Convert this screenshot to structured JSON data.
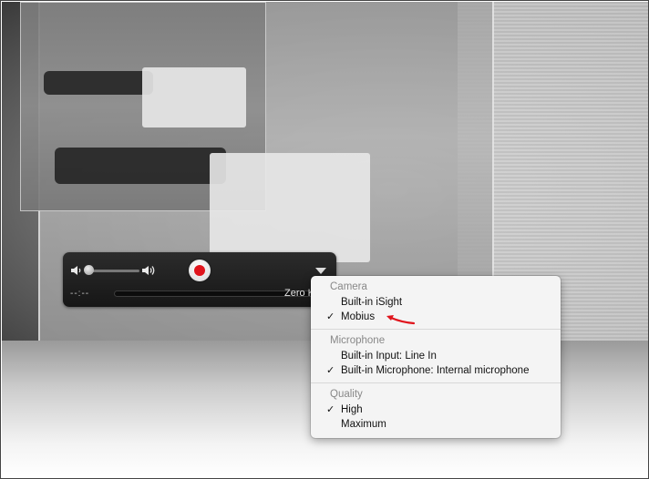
{
  "control_bar": {
    "time_display": "--:--",
    "size_display": "Zero KB",
    "record_color": "#e0141c"
  },
  "menu": {
    "sections": [
      {
        "header": "Camera",
        "items": [
          {
            "label": "Built-in iSight",
            "checked": false
          },
          {
            "label": "Mobius",
            "checked": true
          }
        ]
      },
      {
        "header": "Microphone",
        "items": [
          {
            "label": "Built-in Input: Line In",
            "checked": false
          },
          {
            "label": "Built-in Microphone: Internal microphone",
            "checked": true
          }
        ]
      },
      {
        "header": "Quality",
        "items": [
          {
            "label": "High",
            "checked": true
          },
          {
            "label": "Maximum",
            "checked": false
          }
        ]
      }
    ],
    "check_glyph": "✓"
  },
  "annotation": {
    "color": "#e0141c",
    "target": "Mobius"
  }
}
